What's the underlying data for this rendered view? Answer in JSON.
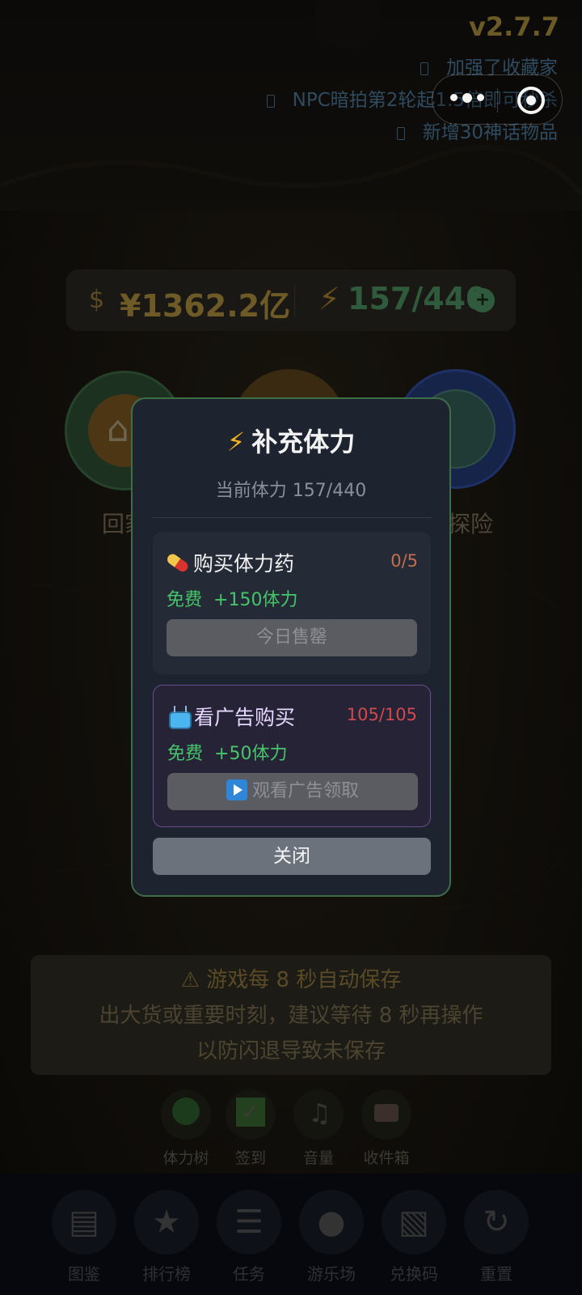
{
  "version": "v2.7.7",
  "update_notes": [
    "加强了收藏家",
    "NPC暗拍第2轮起1.5倍即可秒杀",
    "新增30神话物品"
  ],
  "resources": {
    "money": "¥1362.2亿",
    "stamina": "157/440",
    "money_icon": "money-bag-icon",
    "stamina_icon": "lightning-icon"
  },
  "main_buttons": {
    "home_label": "回家",
    "adventure_label": "探险"
  },
  "modal": {
    "title": "补充体力",
    "current": "当前体力 157/440",
    "potion": {
      "name": "购买体力药",
      "count": "0/5",
      "free": "免费",
      "gain": "+150体力",
      "button": "今日售罄"
    },
    "ad": {
      "name": "看广告购买",
      "count": "105/105",
      "free": "免费",
      "gain": "+50体力",
      "button": "观看广告领取"
    },
    "close": "关闭"
  },
  "warning": {
    "line1": "游戏每 8 秒自动保存",
    "line2": "出大货或重要时刻，建议等待 8 秒再操作",
    "line3": "以防闪退导致未保存"
  },
  "quick_actions": [
    "体力树",
    "签到",
    "音量",
    "收件箱"
  ],
  "nav": [
    "图鉴",
    "排行榜",
    "任务",
    "游乐场",
    "兑换码",
    "重置"
  ],
  "colors": {
    "modal_border": "#3d6e48",
    "free_green": "#46c46a",
    "ad_border": "#6a4d8c",
    "bolt": "#f6b21f"
  }
}
